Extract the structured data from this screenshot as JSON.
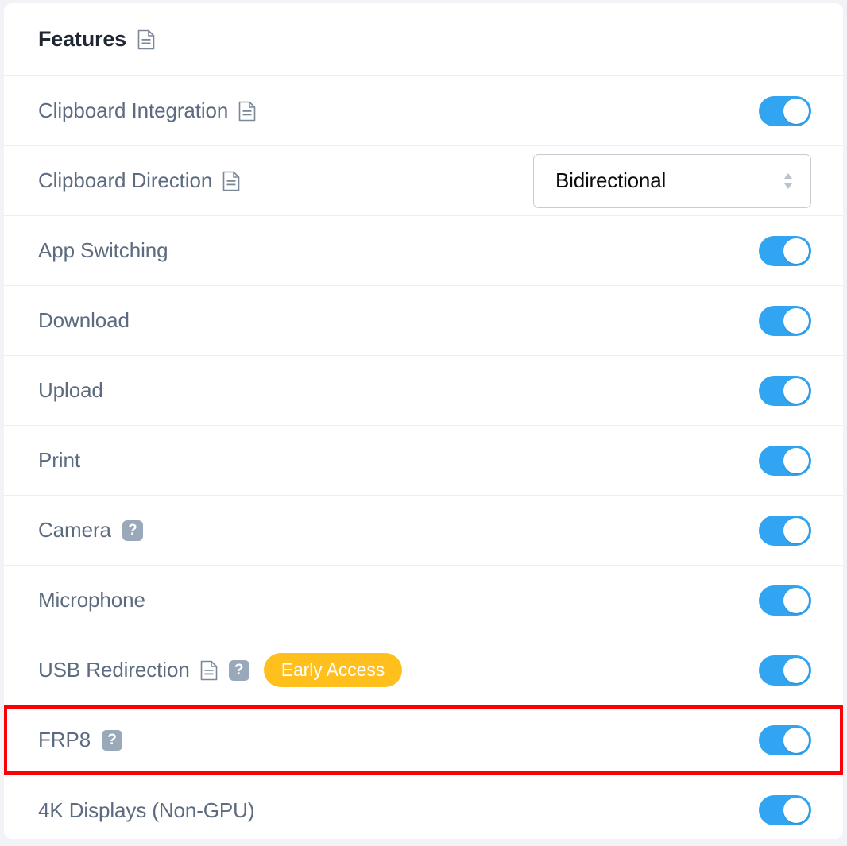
{
  "header": {
    "title": "Features",
    "doc_icon": "document-icon"
  },
  "colors": {
    "accent_toggle_on": "#32a5f2",
    "badge_background": "#ffc01e",
    "badge_text": "#ffffff",
    "label_text": "#5c6b7f",
    "title_text": "#1f2733",
    "help_icon_background": "#9aa9ba",
    "highlight_border": "#fb0007",
    "card_background": "#ffffff",
    "page_background": "#f1f3f6",
    "row_divider": "#eceff3"
  },
  "rows": [
    {
      "label": "Clipboard Integration",
      "doc_icon": "document-icon",
      "help_icon": false,
      "badge": null,
      "control": "toggle",
      "toggle_state": "on",
      "highlighted": false
    },
    {
      "label": "Clipboard Direction",
      "doc_icon": "document-icon",
      "help_icon": false,
      "badge": null,
      "control": "select",
      "select_value": "Bidirectional",
      "highlighted": false
    },
    {
      "label": "App Switching",
      "doc_icon": null,
      "help_icon": false,
      "badge": null,
      "control": "toggle",
      "toggle_state": "on",
      "highlighted": false
    },
    {
      "label": "Download",
      "doc_icon": null,
      "help_icon": false,
      "badge": null,
      "control": "toggle",
      "toggle_state": "on",
      "highlighted": false
    },
    {
      "label": "Upload",
      "doc_icon": null,
      "help_icon": false,
      "badge": null,
      "control": "toggle",
      "toggle_state": "on",
      "highlighted": false
    },
    {
      "label": "Print",
      "doc_icon": null,
      "help_icon": false,
      "badge": null,
      "control": "toggle",
      "toggle_state": "on",
      "highlighted": false
    },
    {
      "label": "Camera",
      "doc_icon": null,
      "help_icon": true,
      "badge": null,
      "control": "toggle",
      "toggle_state": "on",
      "highlighted": false
    },
    {
      "label": "Microphone",
      "doc_icon": null,
      "help_icon": false,
      "badge": null,
      "control": "toggle",
      "toggle_state": "on",
      "highlighted": false
    },
    {
      "label": "USB Redirection",
      "doc_icon": "document-icon",
      "help_icon": true,
      "badge": "Early Access",
      "control": "toggle",
      "toggle_state": "on",
      "highlighted": false
    },
    {
      "label": "FRP8",
      "doc_icon": null,
      "help_icon": true,
      "badge": null,
      "control": "toggle",
      "toggle_state": "on",
      "highlighted": true
    },
    {
      "label": "4K Displays (Non-GPU)",
      "doc_icon": null,
      "help_icon": false,
      "badge": null,
      "control": "toggle",
      "toggle_state": "on",
      "highlighted": false
    }
  ],
  "help_icon_glyph": "?"
}
